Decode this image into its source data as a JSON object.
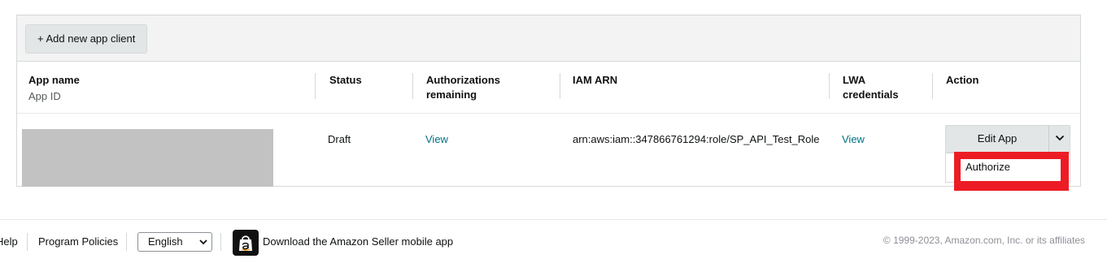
{
  "toolbar": {
    "add_button_label": "+ Add new app client"
  },
  "table": {
    "headers": {
      "app_name": "App name",
      "app_id": "App ID",
      "status": "Status",
      "authorizations_line1": "Authorizations",
      "authorizations_line2": "remaining",
      "iam_arn": "IAM ARN",
      "lwa_line1": "LWA",
      "lwa_line2": "credentials",
      "action": "Action"
    },
    "rows": [
      {
        "status": "Draft",
        "authorizations": "View",
        "iam_arn": "arn:aws:iam::347866761294:role/SP_API_Test_Role",
        "lwa_credentials": "View",
        "action_button": "Edit App",
        "dropdown_items": [
          "Authorize"
        ]
      }
    ]
  },
  "footer": {
    "help": "Help",
    "program_policies": "Program Policies",
    "language": "English",
    "mobile_app": "Download the Amazon Seller mobile app",
    "copyright": "© 1999-2023, Amazon.com, Inc. or its affiliates"
  },
  "colors": {
    "link": "#007185",
    "highlight": "#ed1c24",
    "button_bg": "#e3e6e6"
  }
}
